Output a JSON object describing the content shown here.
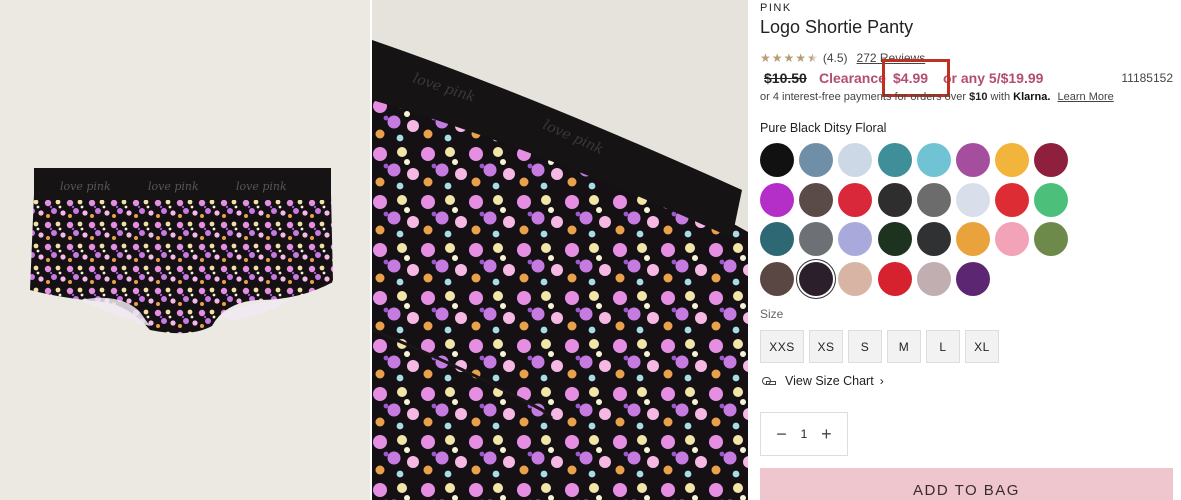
{
  "product": {
    "brand": "PINK",
    "title": "Logo Shortie Panty",
    "rating": "(4.5)",
    "reviews": "272 Reviews",
    "old_price": "$10.50",
    "clearance_label": "Clearance",
    "sale_price": "$4.99",
    "multi_offer": "or any 5/$19.99",
    "sku": "11185152",
    "klarna_prefix": "or 4 interest-free payments for orders over",
    "klarna_threshold": "$10",
    "klarna_with": "with",
    "klarna_brand": "Klarna.",
    "learn_more": "Learn More",
    "waistband_text": "love pink"
  },
  "colors": {
    "selected_name": "Pure Black Ditsy Floral",
    "swatches": [
      "#111111",
      "#6f8fa8",
      "#cdd8e6",
      "#3f8f9b",
      "#6fc3d3",
      "#a64e9e",
      "#f2b43b",
      "#8e1f3d",
      "#b42fc8",
      "#5a4a48",
      "#d8283a",
      "#2e2e2e",
      "#6c6c6c",
      "#d9dfea",
      "#dd2c33",
      "#4cc07a",
      "#2d6874",
      "#6d7176",
      "#a9aadb",
      "#1d3320",
      "#303133",
      "#e9a23c",
      "#f2a3b8",
      "#6d8a4a",
      "#5a4744",
      "#2a1f2a",
      "#d8b4a4",
      "#d6212f",
      "#c0aeb0",
      "#5d2673"
    ]
  },
  "size": {
    "label": "Size",
    "options": [
      "XXS",
      "XS",
      "S",
      "M",
      "L",
      "XL"
    ],
    "chart_link": "View Size Chart"
  },
  "quantity": {
    "minus": "−",
    "value": "1",
    "plus": "+"
  },
  "cta": {
    "add_to_bag": "ADD TO BAG"
  }
}
